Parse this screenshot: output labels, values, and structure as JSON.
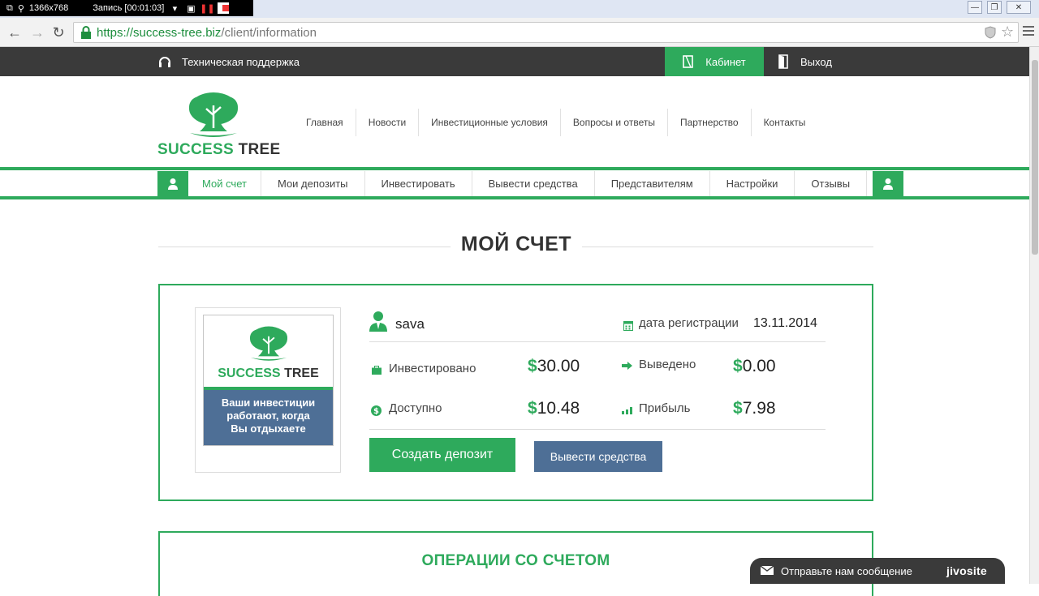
{
  "recorder": {
    "resolution": "1366x768",
    "recording": "Запись [00:01:03]"
  },
  "browser": {
    "url_secure": "https://success-tree.biz",
    "url_path": "/client/information"
  },
  "topbar": {
    "support": "Техническая поддержка",
    "cabinet": "Кабинет",
    "logout": "Выход"
  },
  "logo": {
    "word1": "SUCCESS",
    "word2": "TREE"
  },
  "main_nav": [
    "Главная",
    "Новости",
    "Инвестиционные условия",
    "Вопросы и ответы",
    "Партнерство",
    "Контакты"
  ],
  "account_nav": {
    "active": "Мой счет",
    "items": [
      "Мои депозиты",
      "Инвестировать",
      "Вывести средства",
      "Представителям",
      "Настройки",
      "Отзывы"
    ]
  },
  "page_title": "МОЙ СЧЕТ",
  "banner": {
    "line1": "Ваши инвестиции",
    "line2": "работают, когда",
    "line3": "Вы отдыхаете"
  },
  "account": {
    "username": "sava",
    "reg_label": "дата регистрации",
    "reg_date": "13.11.2014",
    "invested_label": "Инвестировано",
    "invested_value": "30.00",
    "withdrawn_label": "Выведено",
    "withdrawn_value": "0.00",
    "available_label": "Доступно",
    "available_value": "10.48",
    "profit_label": "Прибыль",
    "profit_value": "7.98",
    "currency": "$"
  },
  "buttons": {
    "create_deposit": "Создать депозит",
    "withdraw": "Вывести средства"
  },
  "operations_title": "ОПЕРАЦИИ СО СЧЕТОМ",
  "chat": {
    "label": "Отправьте нам сообщение",
    "brand": "jivosite"
  },
  "colors": {
    "accent": "#2eaa5c",
    "dark": "#3a3a3a",
    "blue": "#4e6f96"
  }
}
